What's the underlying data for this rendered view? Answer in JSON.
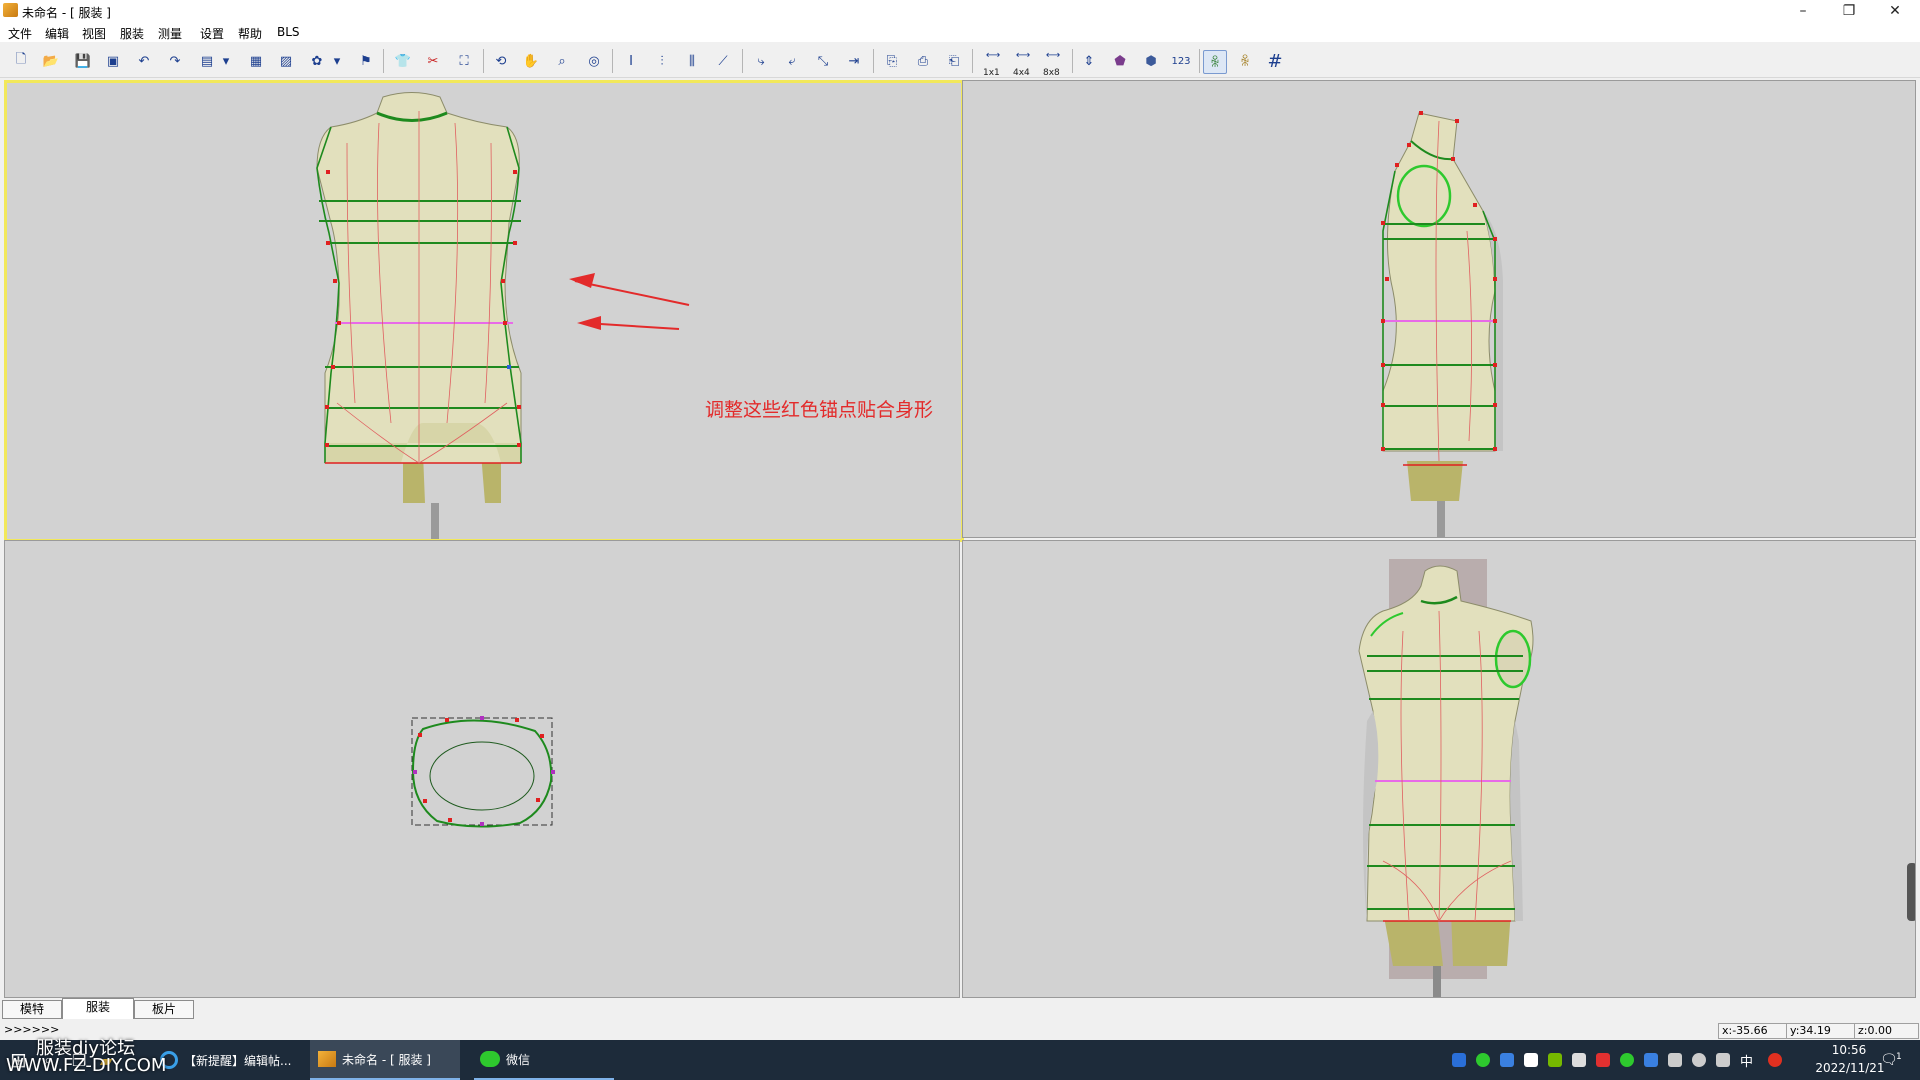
{
  "window": {
    "title": "未命名 - [  服装  ]",
    "controls": {
      "minimize": "–",
      "maximize": "❐",
      "close": "✕"
    }
  },
  "menubar": {
    "items": [
      "文件",
      "编辑",
      "视图",
      "服装",
      "测量",
      "设置",
      "帮助",
      "BLS"
    ]
  },
  "toolbar": {
    "icons": [
      "new-file-icon",
      "open-folder-icon",
      "save-icon",
      "save-as-icon",
      "undo-icon",
      "redo-icon",
      "import-icon",
      "dropdown-icon",
      "layout-icon",
      "chart-icon",
      "flower-icon",
      "dropdown-icon",
      "flag-icon",
      "shirt-icon",
      "cut-shirt-icon",
      "fit-icon",
      "rotate-icon",
      "pan-icon",
      "zoom-icon",
      "orbit-icon",
      "ruler-v-icon",
      "ruler-v2-icon",
      "ruler-grid-icon",
      "measure-tape-icon",
      "curve-icon",
      "curve2-icon",
      "scale-icon",
      "align-icon",
      "load-icon",
      "save-pattern-icon",
      "export-icon",
      "size-1x1-icon",
      "size-4x4-icon",
      "size-8x8-icon",
      "body-height-icon",
      "top-icon",
      "dress-icon",
      "number-icon",
      "body-front-icon",
      "body-back-icon",
      "grid-icon"
    ],
    "size_labels": [
      "1x1",
      "4x4",
      "8x8"
    ],
    "number_label": "123"
  },
  "annotation": {
    "text": "调整这些红色锚点贴合身形",
    "color": "#e32b2b"
  },
  "colors": {
    "viewport_bg": "#d2d2d2",
    "active_border": "#f2e85a",
    "guide_green": "#1e8a1e",
    "guide_red": "#e02020",
    "waist_pink": "#e86ae8",
    "body_fill": "#e2e0bd",
    "leg_fill": "#b9b46a"
  },
  "tabs": [
    "模特",
    "服装",
    "板片"
  ],
  "active_tab": "服装",
  "statusbar": {
    "prompt": ">>>>>>",
    "x": "x:-35.66",
    "y": "y:34.19",
    "z": "z:0.00"
  },
  "taskbar": {
    "tasks": [
      {
        "label": "【新提醒】编辑帖..."
      },
      {
        "label": "未命名 - [  服装  ]"
      },
      {
        "label": "微信"
      }
    ],
    "ime": "中",
    "time": "10:56",
    "date": "2022/11/21",
    "notification_count": "1"
  },
  "watermark": {
    "line1": "服装diy论坛",
    "line2": "WWW.FZ-DIY.COM"
  }
}
